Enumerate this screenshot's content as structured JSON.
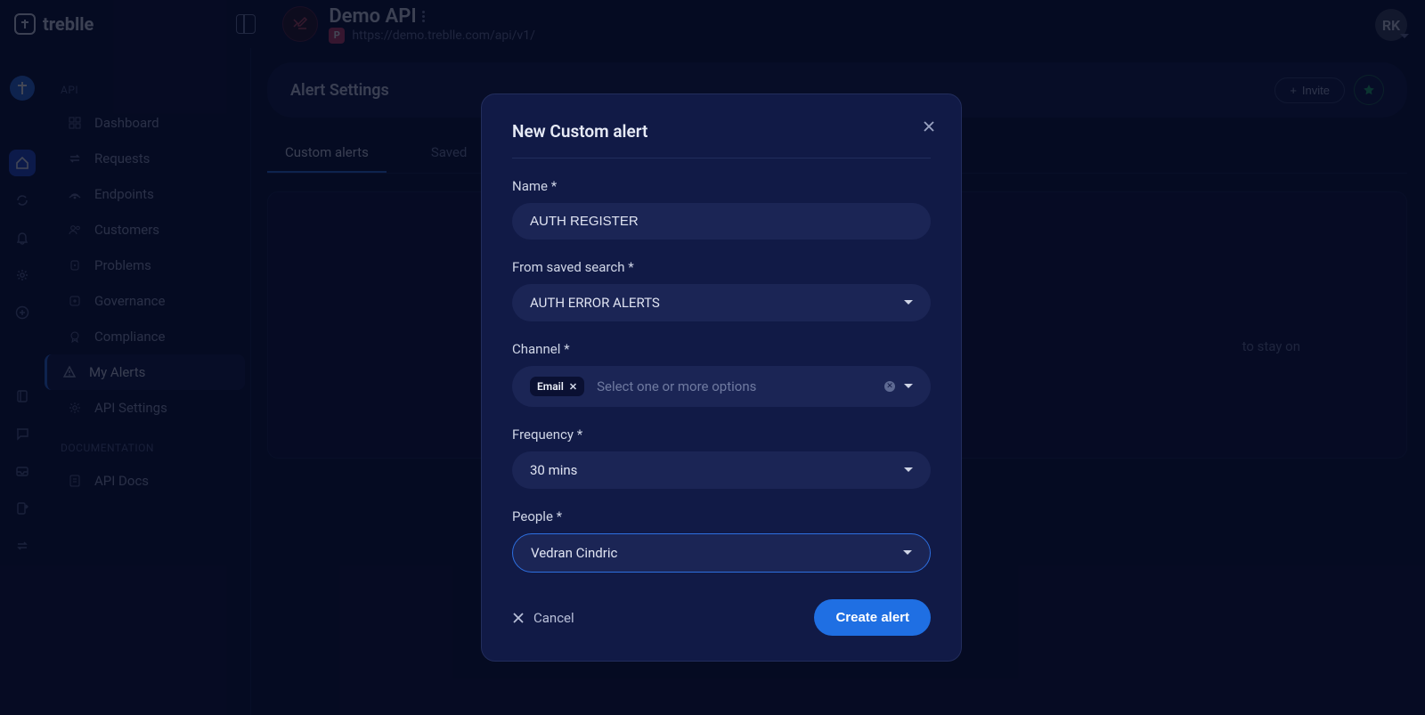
{
  "brand": "treblle",
  "api": {
    "name": "Demo API",
    "url": "https://demo.treblle.com/api/v1/",
    "method_badge": "P"
  },
  "user_initials": "RK",
  "page_title": "Alert Settings",
  "invite_label": "Invite",
  "tabs": [
    "Custom alerts",
    "Saved"
  ],
  "active_tab": 0,
  "hint_line": "to stay on",
  "sidebar": {
    "section_api": "API",
    "section_docs": "DOCUMENTATION",
    "items": [
      {
        "label": "Dashboard"
      },
      {
        "label": "Requests"
      },
      {
        "label": "Endpoints"
      },
      {
        "label": "Customers"
      },
      {
        "label": "Problems"
      },
      {
        "label": "Governance"
      },
      {
        "label": "Compliance"
      },
      {
        "label": "My Alerts"
      },
      {
        "label": "API Settings"
      }
    ],
    "docs_items": [
      {
        "label": "API Docs"
      }
    ]
  },
  "modal": {
    "title": "New Custom alert",
    "labels": {
      "name": "Name *",
      "search": "From saved search *",
      "channel": "Channel *",
      "frequency": "Frequency *",
      "people": "People *"
    },
    "name_value": "AUTH REGISTER",
    "search_value": "AUTH ERROR ALERTS",
    "channel_chip": "Email",
    "channel_placeholder": "Select one or more options",
    "frequency_value": "30 mins",
    "people_value": "Vedran Cindric",
    "cancel": "Cancel",
    "create": "Create alert"
  }
}
